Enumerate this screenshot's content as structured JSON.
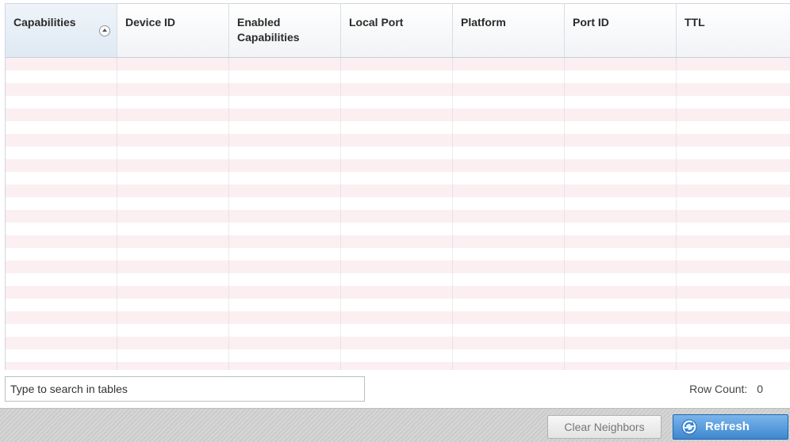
{
  "table": {
    "columns": [
      {
        "label": "Capabilities",
        "sorted": true
      },
      {
        "label": "Device ID"
      },
      {
        "label": "Enabled Capabilities"
      },
      {
        "label": "Local Port"
      },
      {
        "label": "Platform"
      },
      {
        "label": "Port ID"
      },
      {
        "label": "TTL"
      }
    ],
    "rows": []
  },
  "search": {
    "placeholder": "Type to search in tables"
  },
  "row_count": {
    "label": "Row Count:",
    "value": "0"
  },
  "buttons": {
    "clear_neighbors": "Clear Neighbors",
    "refresh": "Refresh"
  },
  "icons": {
    "sort": "sort-ascending-icon",
    "refresh": "refresh-icon"
  },
  "colors": {
    "row_stripe": "#fbeff1",
    "refresh_button": "#3e87d0"
  }
}
